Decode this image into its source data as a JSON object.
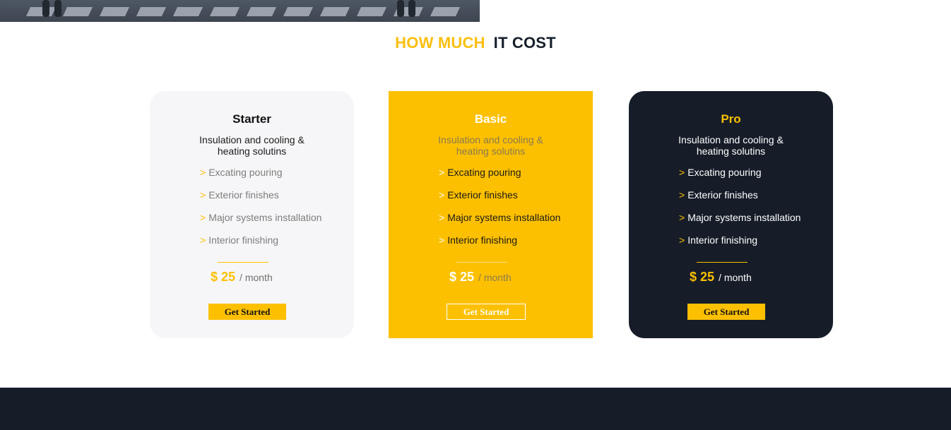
{
  "section": {
    "title_part1": "HOW MUCH",
    "title_part2": "IT COST"
  },
  "plans": [
    {
      "name": "Starter",
      "description_line1": "Insulation and cooling &",
      "description_line2": "heating solutins",
      "features": [
        "Excating pouring",
        "Exterior finishes",
        "Major systems installation",
        "Interior finishing"
      ],
      "price": "$ 25",
      "period": "/ month",
      "cta": "Get Started"
    },
    {
      "name": "Basic",
      "description_line1": "Insulation and cooling &",
      "description_line2": "heating solutins",
      "features": [
        "Excating pouring",
        "Exterior finishes",
        "Major systems installation",
        "Interior finishing"
      ],
      "price": "$ 25",
      "period": "/ month",
      "cta": "Get Started"
    },
    {
      "name": "Pro",
      "description_line1": "Insulation and cooling &",
      "description_line2": "heating solutins",
      "features": [
        "Excating pouring",
        "Exterior finishes",
        "Major systems installation",
        "Interior finishing"
      ],
      "price": "$ 25",
      "period": "/ month",
      "cta": "Get Started"
    }
  ],
  "feature_marker": ">",
  "colors": {
    "accent": "#fdc000",
    "dark": "#161d29",
    "light_card": "#f6f6f8"
  }
}
